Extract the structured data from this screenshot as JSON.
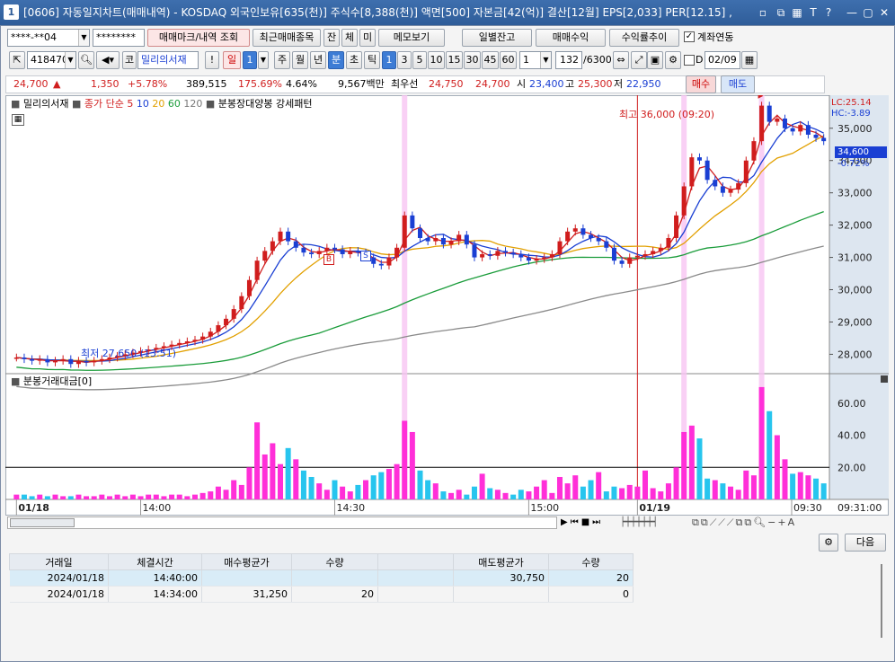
{
  "window": {
    "number": "1",
    "title": "[0606] 자동일지차트(매매내역) - KOSDAQ 외국인보유[635(천)] 주식수[8,388(천)] 액면[500] 자본금[42(억)] 결산[12월] EPS[2,033] PER[12.15] ,"
  },
  "toolbar1": {
    "account": "****-**04",
    "password": "********",
    "mark_btn": "매매마크/내역 조회",
    "recent_btn": "최근매매종목",
    "jan": "잔",
    "che": "체",
    "mi": "미",
    "memo_btn": "메모보기",
    "daily_btn": "일별잔고",
    "profit_btn": "매매수익",
    "rate_btn": "수익률추이",
    "link_label": "계좌연동"
  },
  "toolbar2": {
    "code": "418470",
    "market": "코",
    "name": "밀리의서재",
    "excl": "!",
    "il": "일",
    "il_num": "1",
    "ju": "주",
    "wol": "월",
    "nyeon": "년",
    "bun": "분",
    "cho": "초",
    "tick": "틱",
    "periods": [
      "1",
      "3",
      "5",
      "10",
      "15",
      "30",
      "45",
      "60"
    ],
    "count_val": "1",
    "display": "132",
    "total": "/6300",
    "d_label": "D",
    "date": "02/09"
  },
  "quote": {
    "price": "24,700",
    "arrow": "▲",
    "change": "1,350",
    "pct": "+5.78%",
    "volume": "389,515",
    "vol_ratio": "175.69%",
    "turnover": "4.64%",
    "amount": "9,567백만",
    "best_label": "최우선",
    "best_ask": "24,750",
    "best_bid": "24,700",
    "open_label": "시",
    "open": "23,400",
    "high_label": "고",
    "high": "25,300",
    "low_label": "저",
    "low": "22,950",
    "buy": "매수",
    "sell": "매도"
  },
  "legend": {
    "name": "밀리의서재",
    "close_label": "종가 단순",
    "ma5": "5",
    "ma10": "10",
    "ma20": "20",
    "ma60": "60",
    "ma120": "120",
    "pattern1": "분봉장대양봉",
    "pattern2": "강세패턴",
    "vol_label": "분봉거래대금[0]"
  },
  "annotations": {
    "high": "최고 36,000 (09:20)",
    "low": "최저 27,650 (13:51)",
    "lc": "LC:25.14",
    "hc": "HC:-3.89",
    "cur": "34,600",
    "cur_pct": "-0.72%",
    "b_mark": "B",
    "s_mark": "S"
  },
  "axis": {
    "price_ticks": [
      "35,000",
      "34,000",
      "33,000",
      "32,000",
      "31,000",
      "30,000",
      "29,000",
      "28,000"
    ],
    "vol_ticks": [
      "60.00",
      "40.00",
      "20.00"
    ],
    "x_labels": [
      "01/18",
      "14:00",
      "14:30",
      "15:00",
      "01/19",
      "09:30"
    ],
    "x_right": "09:31:00"
  },
  "bottom": {
    "settings_label": "설정",
    "next_btn": "다음"
  },
  "table": {
    "headers": [
      "거래일",
      "체결시간",
      "매수평균가",
      "수량",
      "",
      "매도평균가",
      "수량"
    ],
    "rows": [
      [
        "2024/01/18",
        "14:40:00",
        "",
        "",
        "",
        "30,750",
        "20"
      ],
      [
        "2024/01/18",
        "14:34:00",
        "31,250",
        "20",
        "",
        "",
        "0"
      ]
    ]
  },
  "chart_data": {
    "type": "candlestick",
    "title": "밀리의서재",
    "y_range": [
      27400,
      35800
    ],
    "x_labels": [
      "01/18",
      "14:00",
      "14:30",
      "15:00",
      "01/19",
      "09:30"
    ],
    "high": {
      "value": 36000,
      "time": "09:20"
    },
    "low": {
      "value": 27650,
      "time": "13:51"
    },
    "series_ma": [
      "5",
      "10",
      "20",
      "60",
      "120"
    ],
    "closes": [
      27900,
      27850,
      27800,
      27850,
      27750,
      27800,
      27850,
      27700,
      27800,
      27750,
      27800,
      27850,
      27900,
      27950,
      28000,
      28050,
      28100,
      28150,
      28200,
      28250,
      28300,
      28350,
      28400,
      28450,
      28550,
      28700,
      28900,
      29100,
      29400,
      29800,
      30300,
      30900,
      31200,
      31500,
      31800,
      31500,
      31300,
      31150,
      31100,
      31200,
      31300,
      31250,
      31100,
      31200,
      31150,
      31000,
      30800,
      30750,
      31000,
      31300,
      32300,
      31900,
      31600,
      31500,
      31600,
      31400,
      31500,
      31700,
      31400,
      31000,
      31100,
      31050,
      31200,
      31150,
      31100,
      31000,
      30900,
      30950,
      31000,
      31100,
      31500,
      31800,
      31900,
      31700,
      31600,
      31500,
      31300,
      30900,
      30800,
      31000,
      31050,
      31100,
      31200,
      31300,
      31600,
      32300,
      33200,
      34100,
      34000,
      33400,
      33200,
      33000,
      33100,
      33300,
      34000,
      34600,
      35700,
      35200,
      35300,
      35000,
      34900,
      35100,
      34800,
      34700,
      34600
    ],
    "volumes": [
      3,
      3,
      2,
      3,
      2,
      3,
      2,
      2,
      3,
      2,
      2,
      3,
      2,
      3,
      2,
      3,
      2,
      3,
      3,
      2,
      3,
      3,
      2,
      3,
      4,
      5,
      8,
      6,
      12,
      9,
      20,
      48,
      28,
      35,
      22,
      32,
      25,
      18,
      14,
      10,
      6,
      12,
      8,
      5,
      9,
      12,
      15,
      17,
      19,
      22,
      49,
      42,
      18,
      12,
      10,
      5,
      4,
      6,
      3,
      8,
      16,
      7,
      6,
      4,
      3,
      6,
      5,
      8,
      12,
      4,
      14,
      10,
      15,
      8,
      12,
      17,
      5,
      8,
      7,
      9,
      8,
      18,
      7,
      5,
      10,
      20,
      42,
      46,
      38,
      13,
      12,
      10,
      8,
      6,
      18,
      15,
      70,
      55,
      40,
      25,
      16,
      17,
      15,
      13,
      10,
      8,
      11,
      12
    ]
  }
}
